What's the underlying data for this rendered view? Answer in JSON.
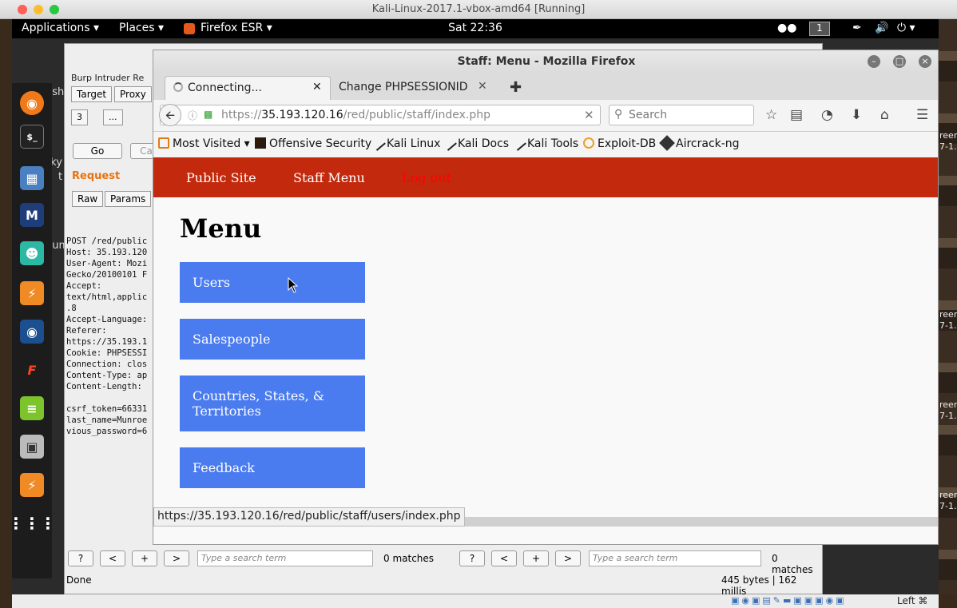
{
  "host": {
    "window_title": "Kali-Linux-2017.1-vbox-amd64 [Running]",
    "thumb_labels": [
      "reen",
      "7-1.",
      "reen",
      "7-1.",
      "reen",
      "7-1.",
      "reen",
      "7-1."
    ],
    "vbox_status_right": "Left ⌘"
  },
  "gnome_bar": {
    "applications": "Applications ▾",
    "places": "Places ▾",
    "active_app": "Firefox ESR ▾",
    "clock": "Sat 22:36",
    "workspace": "1"
  },
  "desktop": {
    "labels": [
      "bash",
      "rocky",
      "t",
      "dum"
    ]
  },
  "burp": {
    "menu": "Burp  Intruder  Re",
    "tabs": [
      "Target",
      "Proxy"
    ],
    "tab_num": "3",
    "tab_more": "...",
    "go": "Go",
    "cancel": "Ca",
    "request_heading": "Request",
    "subtabs": [
      "Raw",
      "Params"
    ],
    "request_text": "POST /red/public\nHost: 35.193.120\nUser-Agent: Mozi\nGecko/20100101 F\nAccept:\ntext/html,applic\n.8\nAccept-Language:\nReferer:\nhttps://35.193.1\nCookie: PHPSESSI\nConnection: clos\nContent-Type: ap\nContent-Length:\n\ncsrf_token=66331\nlast_name=Munroe\nvious_password=6",
    "left_search": {
      "help": "?",
      "prev": "<",
      "add": "+",
      "next": ">",
      "placeholder": "Type a search term",
      "matches": "0 matches"
    },
    "right_search": {
      "help": "?",
      "prev": "<",
      "add": "+",
      "next": ">",
      "placeholder": "Type a search term",
      "matches": "0 matches"
    },
    "status_left": "Done",
    "status_right": "445 bytes | 162 millis"
  },
  "firefox": {
    "window_title": "Staff: Menu - Mozilla Firefox",
    "tabs": [
      {
        "label": "Connecting..."
      },
      {
        "label": "Change PHPSESSIONID"
      }
    ],
    "url_prefix": "https://",
    "url_host": "35.193.120.16",
    "url_path": "/red/public/staff/index.php",
    "search_placeholder": "Search",
    "bookmarks": [
      "Most Visited ▾",
      "Offensive Security",
      "Kali Linux",
      "Kali Docs",
      "Kali Tools",
      "Exploit-DB",
      "Aircrack-ng"
    ],
    "status_url": "https://35.193.120.16/red/public/staff/users/index.php"
  },
  "page": {
    "nav": {
      "public_site": "Public Site",
      "staff_menu": "Staff Menu",
      "logout": "Log out"
    },
    "title": "Menu",
    "menu_items": [
      "Users",
      "Salespeople",
      "Countries, States, & Territories",
      "Feedback"
    ],
    "colors": {
      "header": "#c32a0d",
      "menu_button": "#4a7bef",
      "logout": "#ff0000"
    }
  }
}
